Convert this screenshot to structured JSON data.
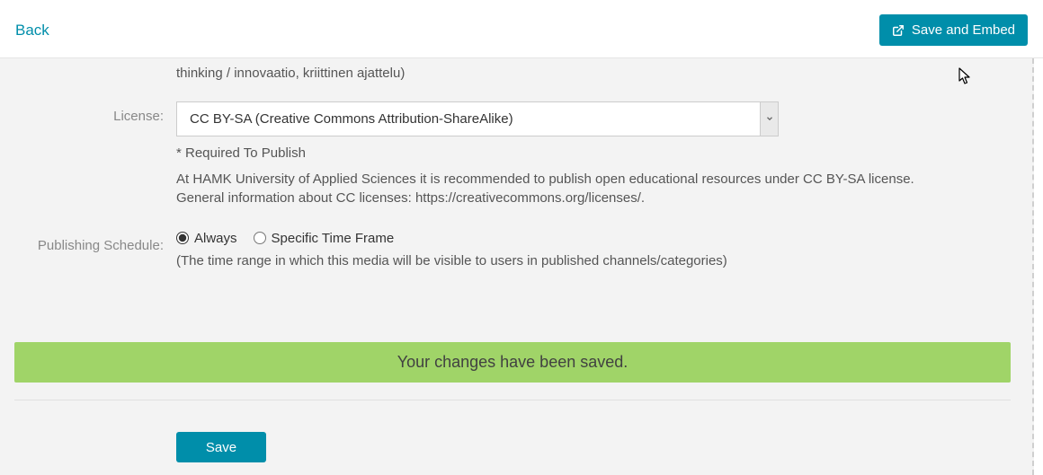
{
  "topbar": {
    "back_label": "Back",
    "save_embed_label": "Save and Embed"
  },
  "clipped_line": "thinking / innovaatio, kriittinen ajattelu)",
  "license": {
    "label": "License:",
    "selected": "CC BY-SA (Creative Commons Attribution-ShareAlike)",
    "required_note": "* Required To Publish",
    "help": "At HAMK University of Applied Sciences it is recommended to publish open educational resources under CC BY-SA license. General information about CC licenses: https://creativecommons.org/licenses/."
  },
  "schedule": {
    "label": "Publishing Schedule:",
    "options": {
      "always": "Always",
      "specific": "Specific Time Frame"
    },
    "help": "(The time range in which this media will be visible to users in published channels/categories)"
  },
  "alert": {
    "message": "Your changes have been saved."
  },
  "actions": {
    "save_label": "Save"
  },
  "colors": {
    "accent": "#008EAA",
    "success_bg": "#A0D468"
  }
}
